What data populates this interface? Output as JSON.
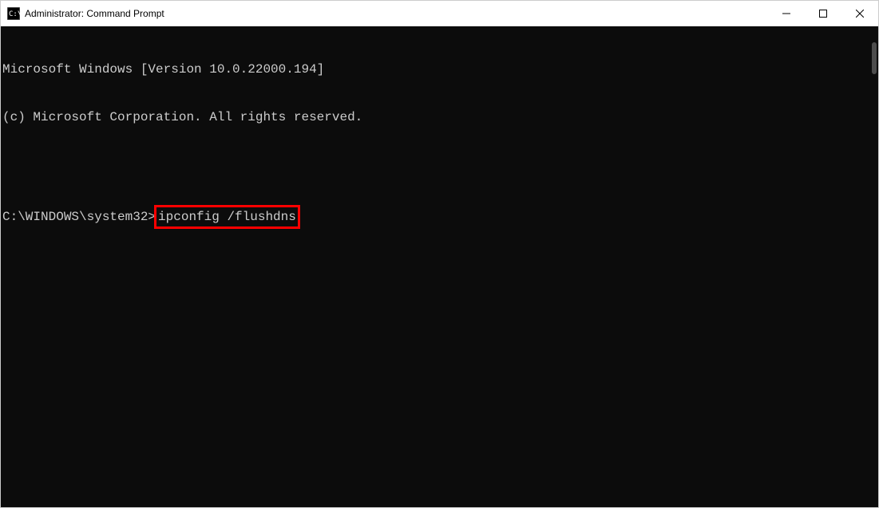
{
  "window": {
    "title": "Administrator: Command Prompt"
  },
  "terminal": {
    "line1": "Microsoft Windows [Version 10.0.22000.194]",
    "line2": "(c) Microsoft Corporation. All rights reserved.",
    "prompt": "C:\\WINDOWS\\system32>",
    "command": "ipconfig /flushdns"
  },
  "highlight": {
    "color": "#ff0000"
  }
}
